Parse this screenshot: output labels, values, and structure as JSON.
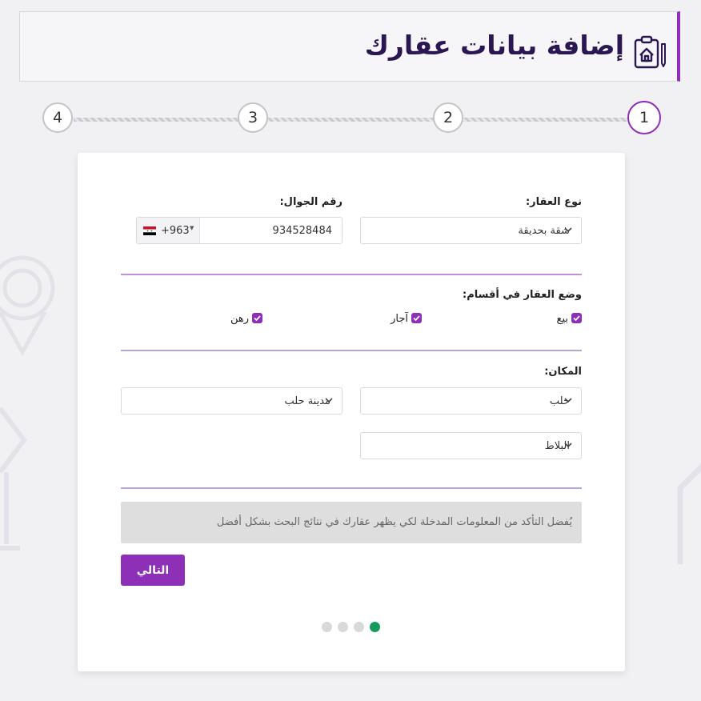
{
  "header": {
    "title": "إضافة بيانات عقارك",
    "icon": "clipboard-house-icon"
  },
  "stepper": {
    "steps": [
      {
        "label": "1",
        "active": true
      },
      {
        "label": "2",
        "active": false
      },
      {
        "label": "3",
        "active": false
      },
      {
        "label": "4",
        "active": false
      }
    ]
  },
  "form": {
    "property_type": {
      "label": "نوع العقار:",
      "value": "شقة بحديقة"
    },
    "phone": {
      "label": "رقم الجوال:",
      "country_code": "+963",
      "number": "934528484",
      "flag": "syria-flag-icon"
    },
    "sections": {
      "label": "وضع العقار في أقسام:",
      "options": [
        {
          "label": "بيع",
          "checked": true
        },
        {
          "label": "آجار",
          "checked": true
        },
        {
          "label": "رهن",
          "checked": true
        }
      ]
    },
    "location": {
      "label": "المكان:",
      "province": "حلب",
      "city": "مدينة حلب",
      "district": "البلاط"
    },
    "notice": "يُفضل التأكد من المعلومات المدخلة لكي يظهر عقارك في نتائج البحث بشكل أفضل",
    "next_button": "التالي"
  },
  "pagination": {
    "count": 4,
    "active_index": 3
  },
  "colors": {
    "accent": "#8e2fb8",
    "active_dot": "#159a5c",
    "title": "#2a1650"
  }
}
